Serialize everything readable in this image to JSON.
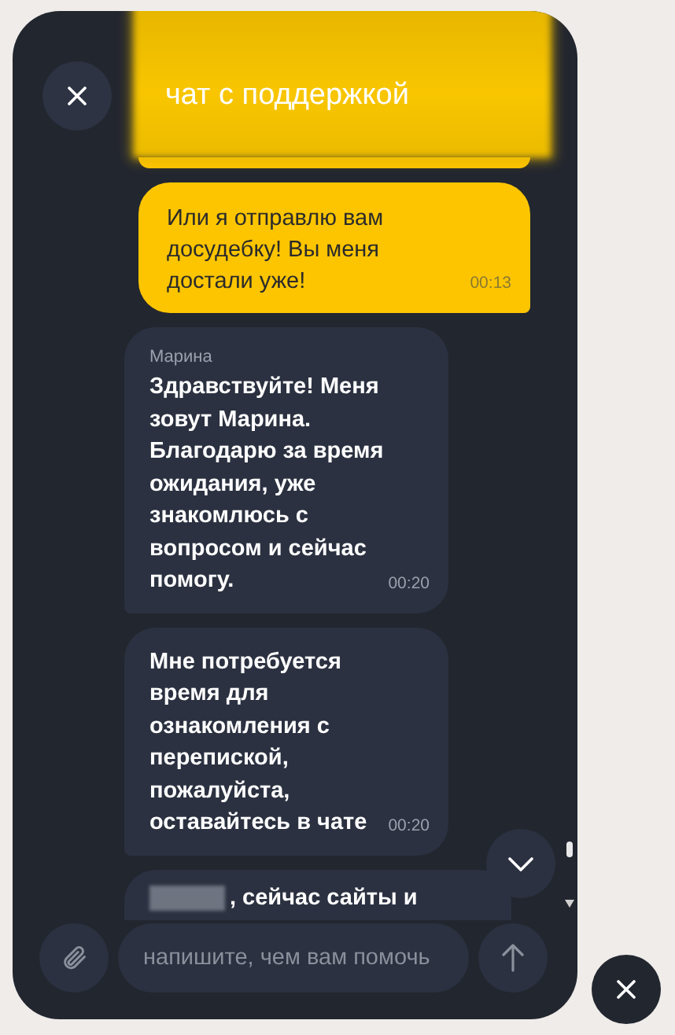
{
  "header": {
    "title": "чат с поддержкой"
  },
  "messages": [
    {
      "kind": "outgoing_edge"
    },
    {
      "kind": "outgoing",
      "text": "Или я отправлю вам досудебку! Вы меня достали уже!",
      "time": "00:13"
    },
    {
      "kind": "incoming",
      "sender": "Марина",
      "text": "Здравствуйте! Меня зовут Марина. Благодарю за время ожидания, уже знакомлюсь с вопросом и сейчас помогу.",
      "time": "00:20"
    },
    {
      "kind": "incoming",
      "text": "Мне потребуется время для ознакомления с перепиской, пожалуйста, оставайтесь в чате",
      "time": "00:20"
    },
    {
      "kind": "incoming_cut",
      "redacted": true,
      "text": ", сейчас сайты и"
    }
  ],
  "composer": {
    "placeholder": "напишите, чем вам помочь"
  }
}
